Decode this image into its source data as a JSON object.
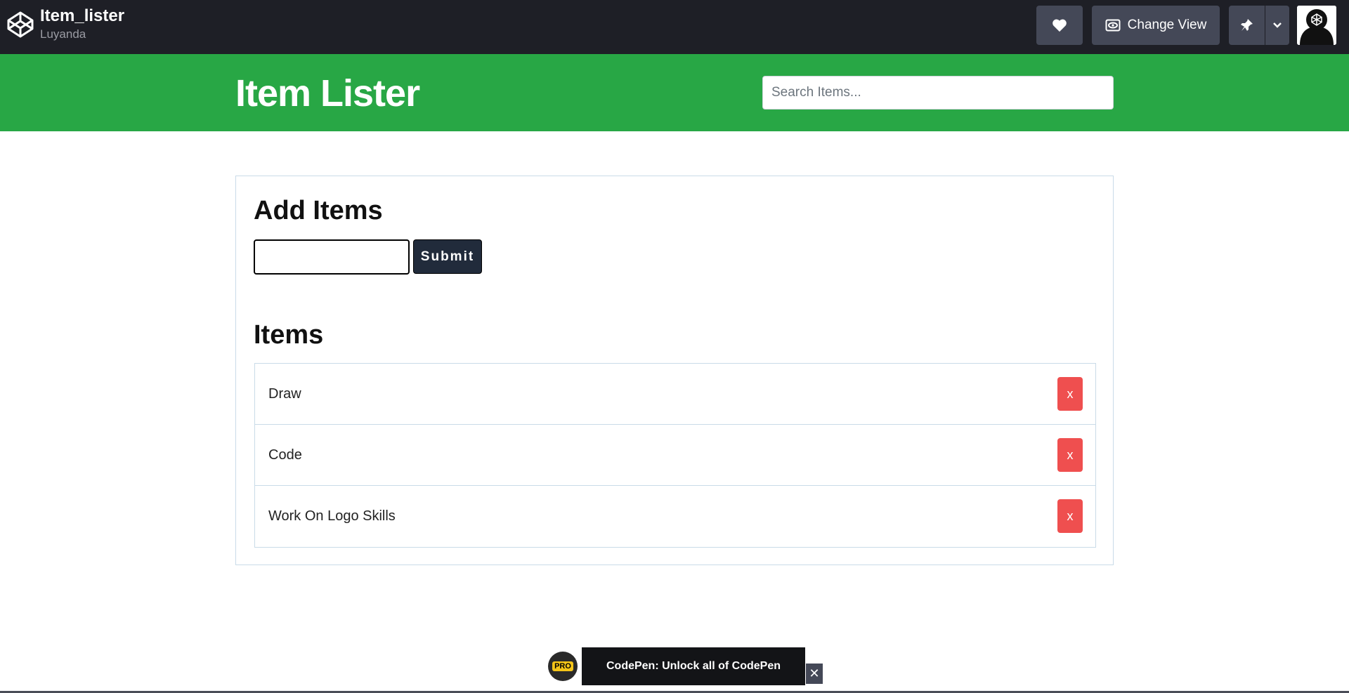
{
  "codepen": {
    "pen_title": "Item_lister",
    "author": "Luyanda",
    "change_view_label": "Change View",
    "icons": {
      "logo": "codepen-logo-icon",
      "like": "heart-icon",
      "view": "eye-icon",
      "pin": "pin-icon",
      "menu": "chevron-down-icon"
    }
  },
  "header": {
    "title": "Item Lister",
    "search_placeholder": "Search Items..."
  },
  "add_form": {
    "title": "Add Items",
    "input_value": "",
    "submit_label": "Submit"
  },
  "items": {
    "title": "Items",
    "list": [
      {
        "label": "Draw",
        "delete_label": "x"
      },
      {
        "label": "Code",
        "delete_label": "x"
      },
      {
        "label": "Work On Logo Skills",
        "delete_label": "x"
      }
    ]
  },
  "promo": {
    "badge": "PRO",
    "text": "CodePen: Unlock all of CodePen",
    "close_label": "✕"
  },
  "colors": {
    "topbar": "#1e1f26",
    "header_green": "#28a745",
    "submit": "#212b3b",
    "delete": "#ef4f4f"
  }
}
